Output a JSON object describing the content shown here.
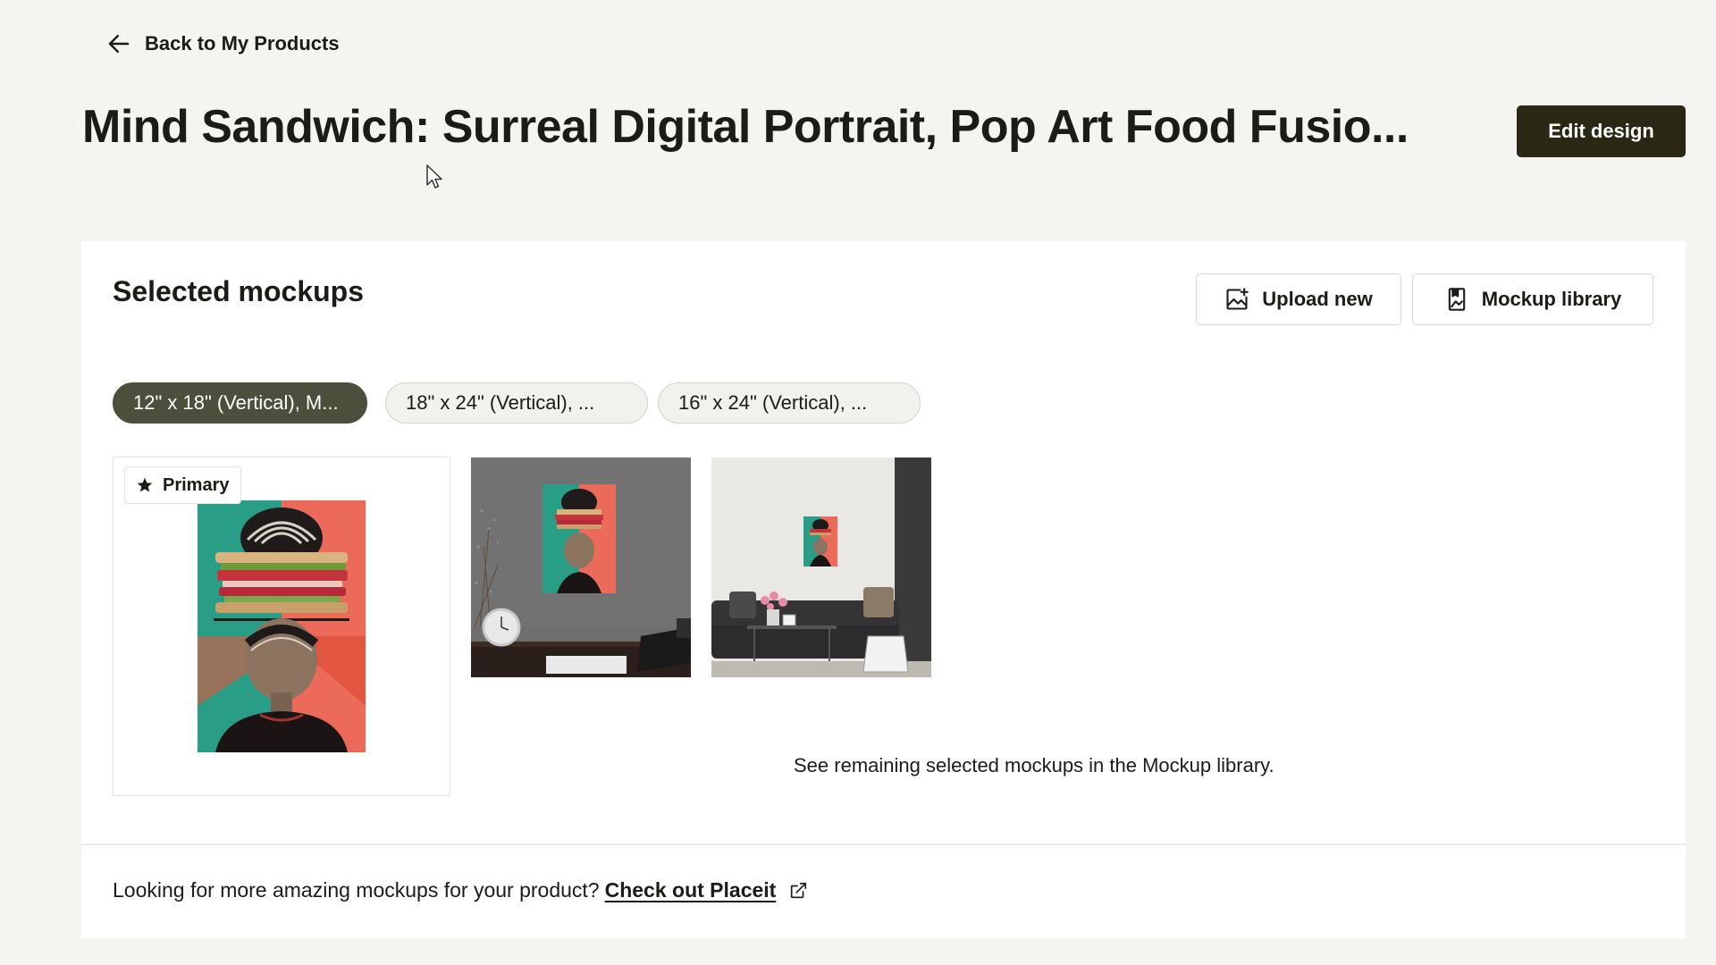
{
  "nav": {
    "back_label": "Back to My Products"
  },
  "header": {
    "title": "Mind Sandwich: Surreal Digital Portrait, Pop Art Food Fusio...",
    "edit_button": "Edit design"
  },
  "mockups": {
    "section_title": "Selected mockups",
    "upload_button": "Upload new",
    "library_button": "Mockup library",
    "variant_tabs": [
      {
        "label": "12\" x 18\" (Vertical), M...",
        "active": true
      },
      {
        "label": "18\" x 24\" (Vertical), ...",
        "active": false
      },
      {
        "label": "16\" x 24\" (Vertical), ...",
        "active": false
      }
    ],
    "primary_badge": "Primary",
    "remaining_note": "See remaining selected mockups in the Mockup library."
  },
  "footer": {
    "prompt": "Looking for more amazing mockups for your product?",
    "link_label": "Check out Placeit"
  },
  "colors": {
    "page_bg": "#f4f4f1",
    "panel_bg": "#ffffff",
    "dark_button": "#2a2815",
    "active_chip": "#4e4e3c",
    "art_teal": "#2a9d86",
    "art_coral": "#ec6a5a"
  },
  "icons": {
    "back": "arrow-left-icon",
    "upload": "image-plus-icon",
    "library": "book-image-icon",
    "primary": "star-icon",
    "external": "external-link-icon"
  }
}
